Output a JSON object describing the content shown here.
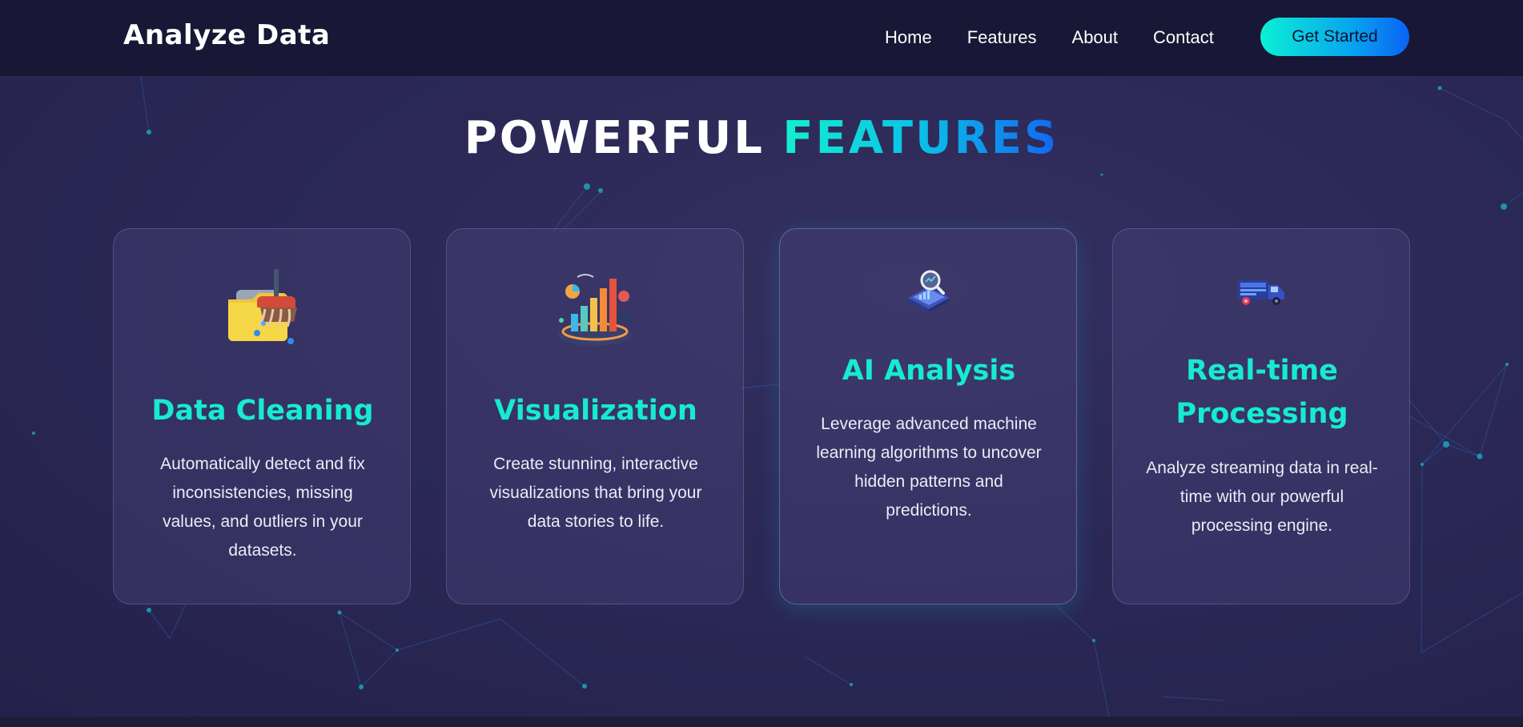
{
  "header": {
    "logo": "Analyze Data",
    "nav": [
      "Home",
      "Features",
      "About",
      "Contact"
    ],
    "cta_label": "Get Started"
  },
  "features_section": {
    "title_part1": "POWERFUL",
    "title_part2": "FEATURES",
    "cards": [
      {
        "icon": "folder-broom-icon",
        "title": "Data Cleaning",
        "description": "Automatically detect and fix inconsistencies, missing values, and outliers in your datasets."
      },
      {
        "icon": "bar-chart-3d-icon",
        "title": "Visualization",
        "description": "Create stunning, interactive visualizations that bring your data stories to life."
      },
      {
        "icon": "laptop-magnifier-icon",
        "title": "AI Analysis",
        "description": "Leverage advanced machine learning algorithms to uncover hidden patterns and predictions."
      },
      {
        "icon": "data-truck-icon",
        "title": "Real-time Processing",
        "description": "Analyze streaming data in real-time with our powerful processing engine."
      }
    ]
  },
  "colors": {
    "accent_teal": "#16ebd0",
    "accent_blue": "#1366f2",
    "background": "#2b2856",
    "navbar": "#181735"
  }
}
